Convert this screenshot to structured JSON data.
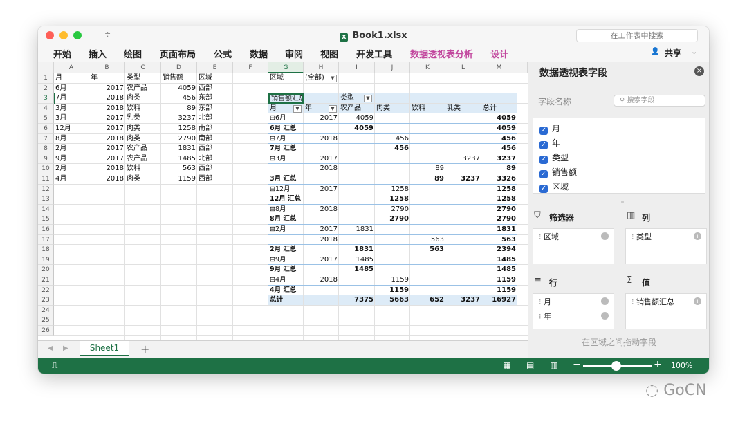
{
  "window": {
    "title": "Book1.xlsx",
    "search_placeholder": "在工作表中搜索",
    "share_label": "共享"
  },
  "ribbon": {
    "tabs": [
      "开始",
      "插入",
      "绘图",
      "页面布局",
      "公式",
      "数据",
      "审阅",
      "视图",
      "开发工具",
      "数据透视表分析",
      "设计"
    ]
  },
  "sheet": {
    "columns": [
      "A",
      "B",
      "C",
      "D",
      "E",
      "F",
      "G",
      "H",
      "I",
      "J",
      "K",
      "L",
      "M"
    ],
    "selected_column": "G",
    "selected_row": 3,
    "rows": [
      1,
      2,
      3,
      4,
      5,
      6,
      7,
      8,
      9,
      10,
      11,
      12,
      13,
      14,
      15,
      16,
      17,
      18,
      19,
      20,
      21,
      22,
      23,
      24,
      25,
      26
    ],
    "source_header": [
      "月",
      "年",
      "类型",
      "销售额",
      "区域"
    ],
    "source_rows": [
      [
        "6月",
        "2017",
        "农产品",
        "4059",
        "西部"
      ],
      [
        "7月",
        "2018",
        "肉类",
        "456",
        "东部"
      ],
      [
        "3月",
        "2018",
        "饮料",
        "89",
        "东部"
      ],
      [
        "3月",
        "2017",
        "乳类",
        "3237",
        "北部"
      ],
      [
        "12月",
        "2017",
        "肉类",
        "1258",
        "南部"
      ],
      [
        "8月",
        "2018",
        "肉类",
        "2790",
        "南部"
      ],
      [
        "2月",
        "2017",
        "农产品",
        "1831",
        "西部"
      ],
      [
        "9月",
        "2017",
        "农产品",
        "1485",
        "北部"
      ],
      [
        "2月",
        "2018",
        "饮料",
        "563",
        "西部"
      ],
      [
        "4月",
        "2018",
        "肉类",
        "1159",
        "西部"
      ]
    ]
  },
  "pivot": {
    "filter_label": "区域",
    "filter_value": "(全部)",
    "values_label": "销售额汇总",
    "col_field": "类型",
    "row_field_1": "月",
    "row_field_2": "年",
    "col_headers": [
      "农产品",
      "肉类",
      "饮料",
      "乳类",
      "总计"
    ],
    "rows": [
      {
        "g": "⊟6月",
        "h": "2017",
        "i": "4059",
        "j": "",
        "k": "",
        "l": "",
        "m": "4059",
        "bold": false
      },
      {
        "g": "6月 汇总",
        "h": "",
        "i": "4059",
        "j": "",
        "k": "",
        "l": "",
        "m": "4059",
        "bold": true
      },
      {
        "g": "⊟7月",
        "h": "2018",
        "i": "",
        "j": "456",
        "k": "",
        "l": "",
        "m": "456",
        "bold": false
      },
      {
        "g": "7月 汇总",
        "h": "",
        "i": "",
        "j": "456",
        "k": "",
        "l": "",
        "m": "456",
        "bold": true
      },
      {
        "g": "⊟3月",
        "h": "2017",
        "i": "",
        "j": "",
        "k": "",
        "l": "3237",
        "m": "3237",
        "bold": false
      },
      {
        "g": "",
        "h": "2018",
        "i": "",
        "j": "",
        "k": "89",
        "l": "",
        "m": "89",
        "bold": false
      },
      {
        "g": "3月 汇总",
        "h": "",
        "i": "",
        "j": "",
        "k": "89",
        "l": "3237",
        "m": "3326",
        "bold": true
      },
      {
        "g": "⊟12月",
        "h": "2017",
        "i": "",
        "j": "1258",
        "k": "",
        "l": "",
        "m": "1258",
        "bold": false
      },
      {
        "g": "12月 汇总",
        "h": "",
        "i": "",
        "j": "1258",
        "k": "",
        "l": "",
        "m": "1258",
        "bold": true
      },
      {
        "g": "⊟8月",
        "h": "2018",
        "i": "",
        "j": "2790",
        "k": "",
        "l": "",
        "m": "2790",
        "bold": false
      },
      {
        "g": "8月 汇总",
        "h": "",
        "i": "",
        "j": "2790",
        "k": "",
        "l": "",
        "m": "2790",
        "bold": true
      },
      {
        "g": "⊟2月",
        "h": "2017",
        "i": "1831",
        "j": "",
        "k": "",
        "l": "",
        "m": "1831",
        "bold": false
      },
      {
        "g": "",
        "h": "2018",
        "i": "",
        "j": "",
        "k": "563",
        "l": "",
        "m": "563",
        "bold": false
      },
      {
        "g": "2月 汇总",
        "h": "",
        "i": "1831",
        "j": "",
        "k": "563",
        "l": "",
        "m": "2394",
        "bold": true
      },
      {
        "g": "⊟9月",
        "h": "2017",
        "i": "1485",
        "j": "",
        "k": "",
        "l": "",
        "m": "1485",
        "bold": false
      },
      {
        "g": "9月 汇总",
        "h": "",
        "i": "1485",
        "j": "",
        "k": "",
        "l": "",
        "m": "1485",
        "bold": true
      },
      {
        "g": "⊟4月",
        "h": "2018",
        "i": "",
        "j": "1159",
        "k": "",
        "l": "",
        "m": "1159",
        "bold": false
      },
      {
        "g": "4月 汇总",
        "h": "",
        "i": "",
        "j": "1159",
        "k": "",
        "l": "",
        "m": "1159",
        "bold": true
      },
      {
        "g": "总计",
        "h": "",
        "i": "7375",
        "j": "5663",
        "k": "652",
        "l": "3237",
        "m": "16927",
        "bold": true
      }
    ]
  },
  "sheet_tabs": {
    "active": "Sheet1",
    "add_label": "+"
  },
  "status": {
    "zoom": "100%",
    "zoom_level_percent": 100
  },
  "pane": {
    "title": "数据透视表字段",
    "field_name_label": "字段名称",
    "search_placeholder": "搜索字段",
    "fields": [
      {
        "label": "月",
        "checked": true
      },
      {
        "label": "年",
        "checked": true
      },
      {
        "label": "类型",
        "checked": true
      },
      {
        "label": "销售额",
        "checked": true
      },
      {
        "label": "区域",
        "checked": true
      }
    ],
    "filters_title": "筛选器",
    "columns_title": "列",
    "rows_title": "行",
    "values_title": "值",
    "filter_items": [
      "区域"
    ],
    "column_items": [
      "类型"
    ],
    "row_items": [
      "月",
      "年"
    ],
    "value_items": [
      "销售额汇总"
    ],
    "drag_hint": "在区域之间拖动字段"
  },
  "colors": {
    "excel_green": "#1e7145",
    "pivot_tab": "#c2479e",
    "pivot_fill": "#ddebf7",
    "checkbox_blue": "#2a6ad3"
  },
  "watermark": "GoCN"
}
